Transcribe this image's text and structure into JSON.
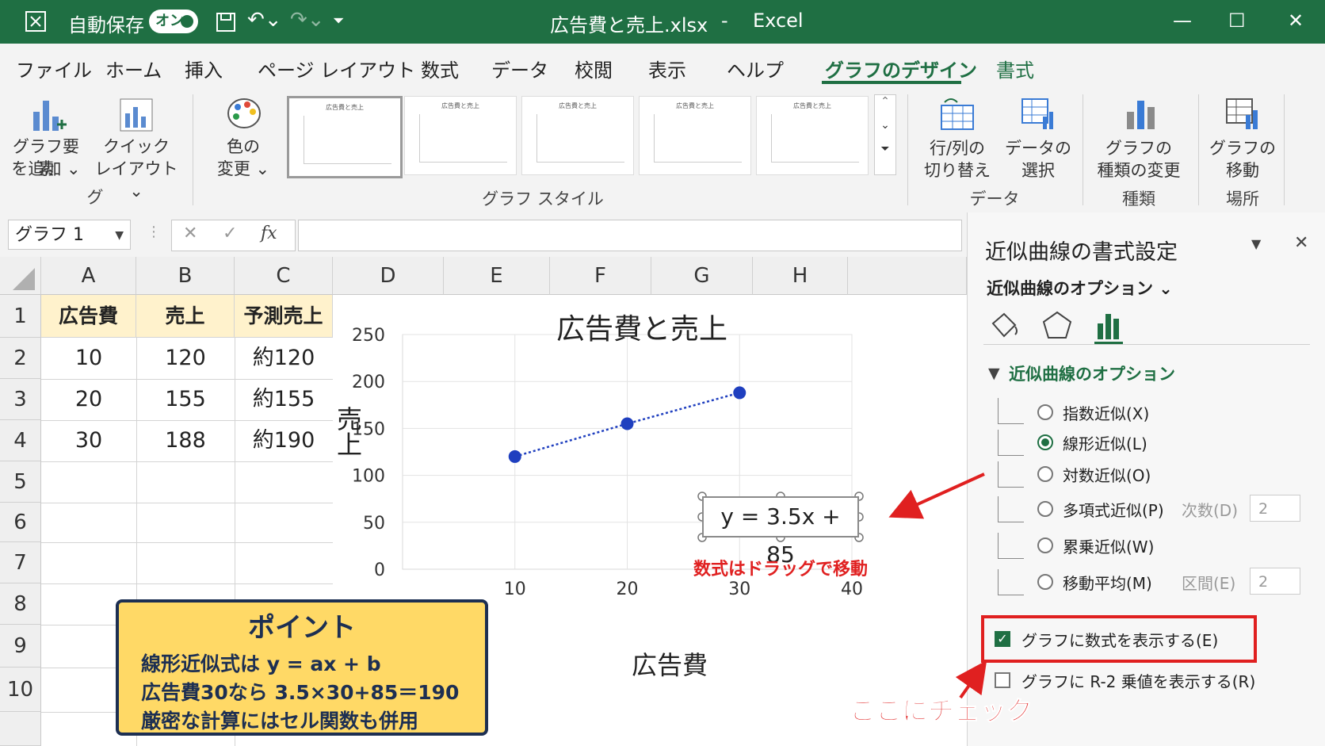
{
  "titlebar": {
    "autosave_label": "自動保存",
    "autosave_state": "オン",
    "filename": "広告費と売上.xlsx",
    "separator": "-",
    "app": "Excel",
    "min_glyph": "—",
    "max_glyph": "☐",
    "close_glyph": "✕"
  },
  "tabs": [
    "ファイル",
    "ホーム",
    "挿入",
    "ページ レイアウト",
    "数式",
    "データ",
    "校閲",
    "表示",
    "ヘルプ",
    "グラフのデザイン",
    "書式"
  ],
  "active_tab": "グラフのデザイン",
  "ribbon": {
    "add_element": [
      "グラフ要素",
      "を追加 ⌄"
    ],
    "quick_layout": [
      "クイック",
      "レイアウト ⌄"
    ],
    "group_layout": "グ",
    "colors": [
      "色の",
      "変更 ⌄"
    ],
    "group_styles": "グラフ スタイル",
    "thumb_title": "広告費と売上",
    "switch_rowcol": [
      "行/列の",
      "切り替え"
    ],
    "select_data": [
      "データの",
      "選択"
    ],
    "group_data": "データ",
    "change_type": [
      "グラフの",
      "種類の変更"
    ],
    "group_type": "種類",
    "move_chart": [
      "グラフの",
      "移動"
    ],
    "group_location": "場所"
  },
  "formula_bar": {
    "name_box": "グラフ 1",
    "cancel": "✕",
    "enter": "✓",
    "fx": "fx",
    "value": ""
  },
  "grid": {
    "columns": [
      "A",
      "B",
      "C",
      "D",
      "E",
      "F",
      "G",
      "H"
    ],
    "rows": [
      "1",
      "2",
      "3",
      "4",
      "5",
      "6",
      "7",
      "8",
      "9",
      "10"
    ],
    "headers": [
      "広告費",
      "売上",
      "予測売上"
    ],
    "data": [
      [
        "10",
        "120",
        "約120"
      ],
      [
        "20",
        "155",
        "約155"
      ],
      [
        "30",
        "188",
        "約190"
      ]
    ]
  },
  "chart_data": {
    "type": "scatter",
    "title": "広告費と売上",
    "xlabel": "広告費",
    "ylabel": "売上",
    "x": [
      10,
      20,
      30
    ],
    "y": [
      120,
      155,
      188
    ],
    "xlim": [
      0,
      40
    ],
    "ylim": [
      0,
      250
    ],
    "xticks": [
      "10",
      "20",
      "30",
      "40"
    ],
    "yticks": [
      "250",
      "200",
      "150",
      "100",
      "50",
      "0"
    ],
    "trendline": "linear-dotted",
    "equation": "y = 3.5x + 85",
    "marker_color": "#1f3fbf",
    "grid": true
  },
  "annotations": {
    "drag_hint": "数式はドラッグで移動",
    "check_hint": "ここにチェック",
    "accent_color": "#e02020"
  },
  "point_box": {
    "title": "ポイント",
    "lines": [
      "線形近似式は y = ax + b",
      "広告費30なら 3.5×30+85＝190",
      "厳密な計算にはセル関数も併用"
    ]
  },
  "pane": {
    "title": "近似曲線の書式設定",
    "subtitle": "近似曲線のオプション ⌄",
    "section": "近似曲線のオプション",
    "options": [
      {
        "label": "指数近似(X)",
        "selected": false
      },
      {
        "label": "線形近似(L)",
        "selected": true
      },
      {
        "label": "対数近似(O)",
        "selected": false
      },
      {
        "label": "多項式近似(P)",
        "selected": false
      },
      {
        "label": "累乗近似(W)",
        "selected": false
      },
      {
        "label": "移動平均(M)",
        "selected": false
      }
    ],
    "order_label": "次数(D)",
    "order_value": "2",
    "period_label": "区間(E)",
    "period_value": "2",
    "show_equation": "グラフに数式を表示する(E)",
    "show_r2": "グラフに R-2 乗値を表示する(R)"
  }
}
